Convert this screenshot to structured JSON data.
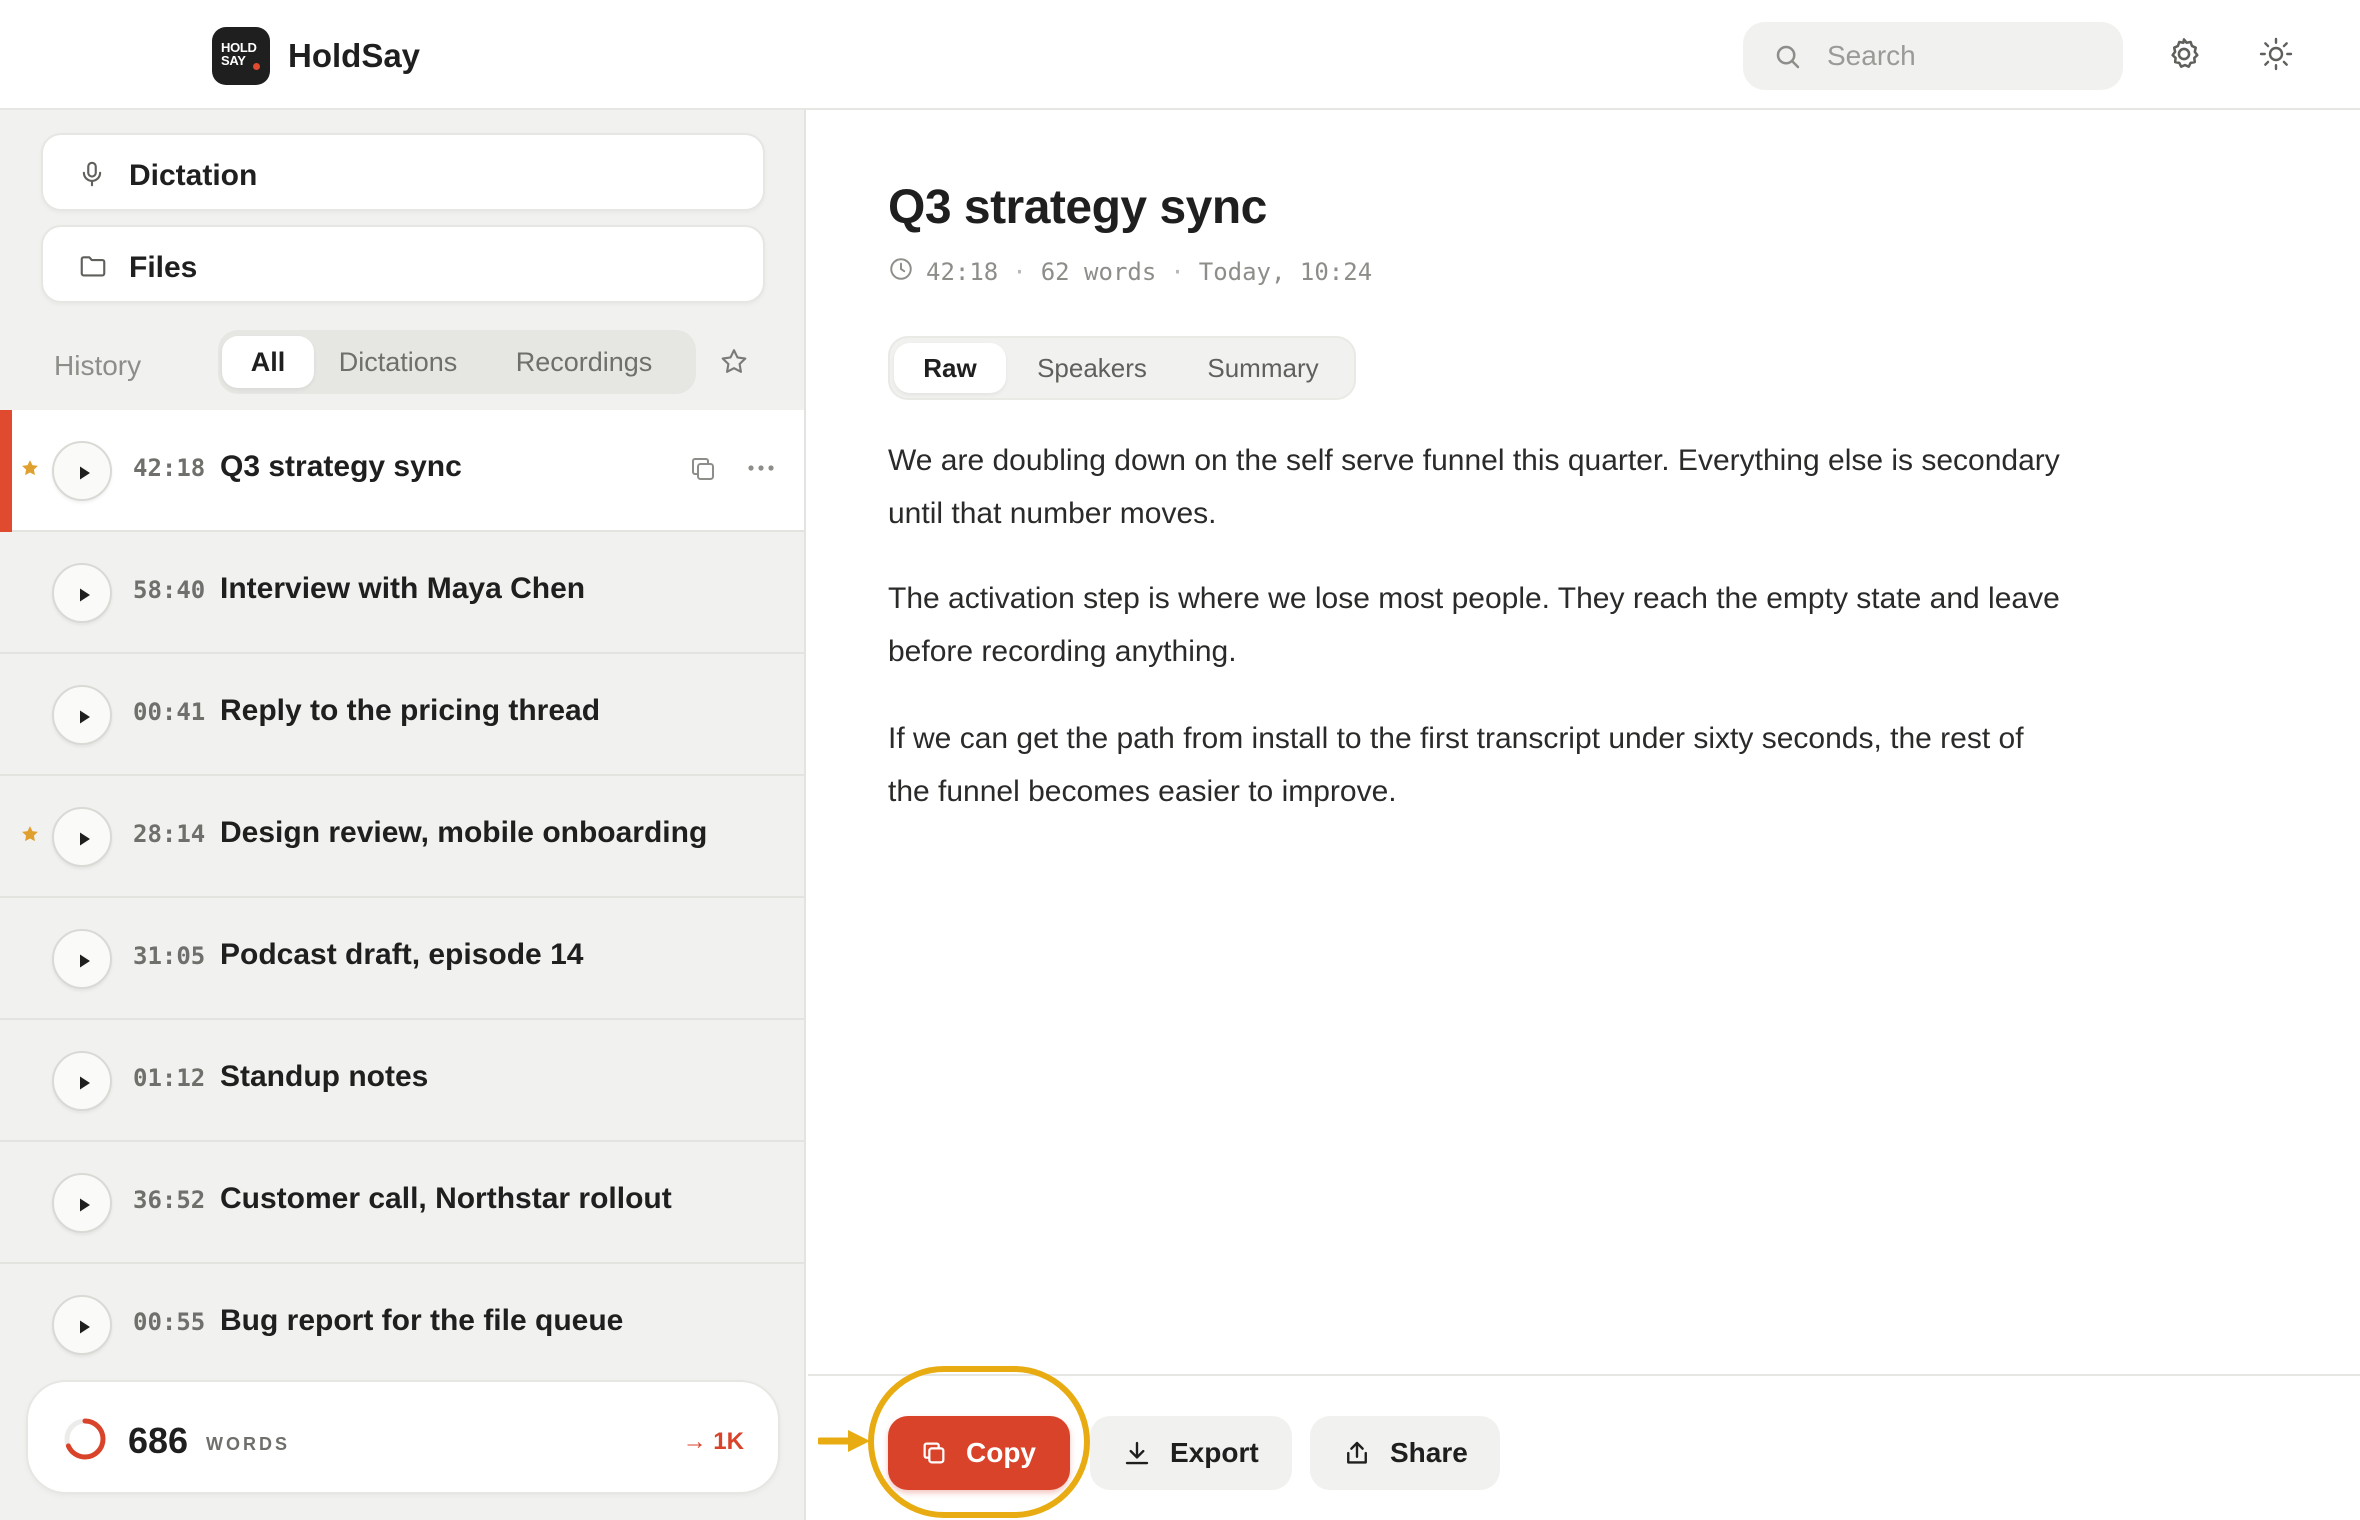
{
  "app": {
    "name": "HoldSay",
    "logo_text_line1": "HOLD",
    "logo_text_line2": "SAY"
  },
  "header": {
    "search_placeholder": "Search"
  },
  "sidebar": {
    "nav": [
      {
        "label": "Dictation",
        "icon": "microphone-icon"
      },
      {
        "label": "Files",
        "icon": "folder-icon"
      }
    ],
    "history_label": "History",
    "filters": [
      "All",
      "Dictations",
      "Recordings"
    ],
    "active_filter": "All",
    "items": [
      {
        "duration": "42:18",
        "title": "Q3 strategy sync",
        "starred": true,
        "selected": true
      },
      {
        "duration": "58:40",
        "title": "Interview with Maya Chen",
        "starred": false,
        "selected": false
      },
      {
        "duration": "00:41",
        "title": "Reply to the pricing thread",
        "starred": false,
        "selected": false
      },
      {
        "duration": "28:14",
        "title": "Design review, mobile onboarding",
        "starred": true,
        "selected": false
      },
      {
        "duration": "31:05",
        "title": "Podcast draft, episode 14",
        "starred": false,
        "selected": false
      },
      {
        "duration": "01:12",
        "title": "Standup notes",
        "starred": false,
        "selected": false
      },
      {
        "duration": "36:52",
        "title": "Customer call, Northstar rollout",
        "starred": false,
        "selected": false
      },
      {
        "duration": "00:55",
        "title": "Bug report for the file queue",
        "starred": false,
        "selected": false
      }
    ],
    "word_counter": {
      "value": "686",
      "unit": "WORDS",
      "goal": "→ 1K",
      "progress": 0.686
    }
  },
  "document": {
    "title": "Q3 strategy sync",
    "duration": "42:18",
    "words": "62 words",
    "date": "Today, 10:24",
    "tabs": [
      "Raw",
      "Speakers",
      "Summary"
    ],
    "active_tab": "Raw",
    "paragraphs": [
      "We are doubling down on the self serve funnel this quarter. Everything else is secondary until that number moves.",
      "The activation step is where we lose most people. They reach the empty state and leave before recording anything.",
      "If we can get the path from install to the first transcript under sixty seconds, the rest of the funnel becomes easier to improve."
    ]
  },
  "actions": {
    "copy": "Copy",
    "export": "Export",
    "share": "Share"
  },
  "colors": {
    "accent": "#d9432a",
    "star": "#e0a030",
    "highlight": "#e8ac12",
    "sidebar_bg": "#f1f1ef"
  }
}
